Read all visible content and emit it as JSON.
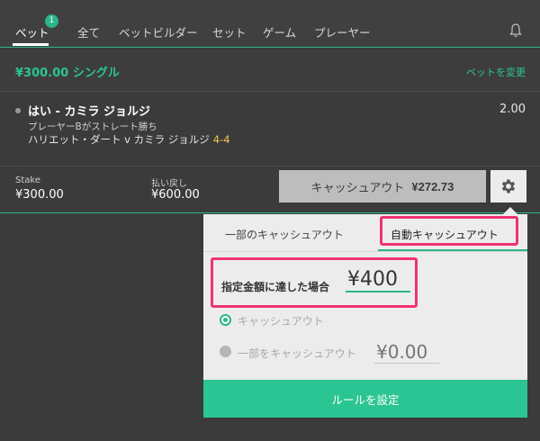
{
  "nav": {
    "items": [
      "ベット",
      "全て",
      "ベットビルダー",
      "セット",
      "ゲーム",
      "プレーヤー"
    ],
    "badge": "1",
    "bell_icon": "bell-icon"
  },
  "betslip": {
    "title": "¥300.00 シングル",
    "change_bet": "ベットを変更"
  },
  "selection": {
    "name": "はい - カミラ ジョルジ",
    "odds": "2.00",
    "market": "プレーヤーBがストレート勝ち",
    "event": "ハリエット・ダート v カミラ ジョルジ",
    "score": "4-4"
  },
  "stake": {
    "stake_label": "Stake",
    "stake_value": "¥300.00",
    "returns_label": "払い戻し",
    "returns_value": "¥600.00",
    "cashout_label": "キャッシュアウト",
    "cashout_amount": "¥272.73",
    "settings_icon": "gear-icon"
  },
  "auto_cashout": {
    "tab_partial": "一部のキャッシュアウト",
    "tab_auto": "自動キャッシュアウト",
    "when_label": "指定金額に達した場合",
    "amount_value": "¥400",
    "option_full": "キャッシュアウト",
    "option_partial": "一部をキャッシュアウト",
    "partial_placeholder": "¥0.00",
    "set_rule": "ルールを設定"
  },
  "colors": {
    "accent": "#2bc593",
    "highlight": "#f0336e",
    "score": "#f2c94c"
  }
}
